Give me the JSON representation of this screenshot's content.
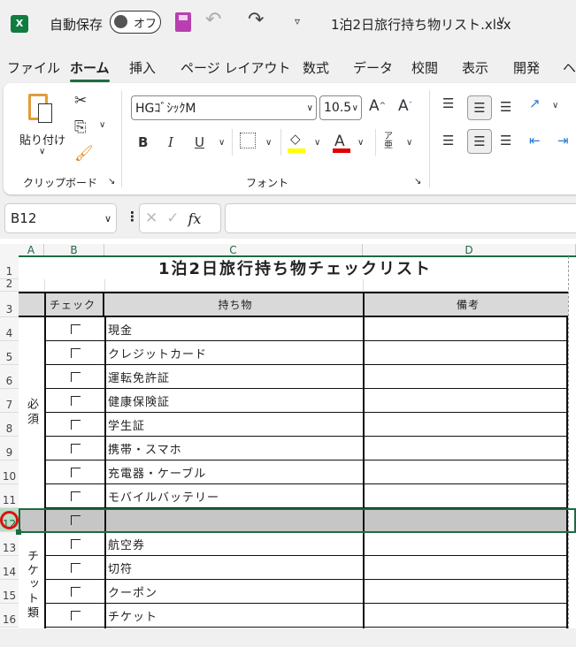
{
  "titlebar": {
    "autosave_label": "自動保存",
    "autosave_state": "オフ",
    "filename": "1泊2日旅行持ち物リスト.xlsx"
  },
  "tabs": [
    {
      "label": "ファイル"
    },
    {
      "label": "ホーム",
      "active": true
    },
    {
      "label": "挿入"
    },
    {
      "label": "ページ レイアウト"
    },
    {
      "label": "数式"
    },
    {
      "label": "データ"
    },
    {
      "label": "校閲"
    },
    {
      "label": "表示"
    },
    {
      "label": "開発"
    },
    {
      "label": "ヘ"
    }
  ],
  "ribbon": {
    "paste_label": "貼り付け",
    "clipboard_group": "クリップボード",
    "font_group": "フォント",
    "font_name": "HGｺﾞｼｯｸM",
    "font_size": "10.5",
    "bold": "B",
    "italic": "I",
    "underline": "U",
    "font_color_letter": "A",
    "highlight_color": "#ffff00",
    "font_color": "#e00000"
  },
  "formula_bar": {
    "name_box": "B12",
    "fx": "fx",
    "formula": ""
  },
  "sheet": {
    "columns": [
      "A",
      "B",
      "C",
      "D"
    ],
    "title": "1泊2日旅行持ち物チェックリスト",
    "headers": {
      "check": "チェック",
      "item": "持ち物",
      "note": "備考"
    },
    "row_numbers": [
      "1",
      "2",
      "3",
      "4",
      "5",
      "6",
      "7",
      "8",
      "9",
      "10",
      "11",
      "12",
      "13",
      "14",
      "15",
      "16"
    ],
    "groups": [
      {
        "label": "必須"
      },
      {
        "label": "チケット類"
      }
    ],
    "items": [
      "現金",
      "クレジットカード",
      "運転免許証",
      "健康保険証",
      "学生証",
      "携帯・スマホ",
      "充電器・ケーブル",
      "モバイルバッテリー",
      "",
      "航空券",
      "切符",
      "クーポン",
      "チケット"
    ],
    "selected_row": "12",
    "accent": "#1e6b41"
  }
}
